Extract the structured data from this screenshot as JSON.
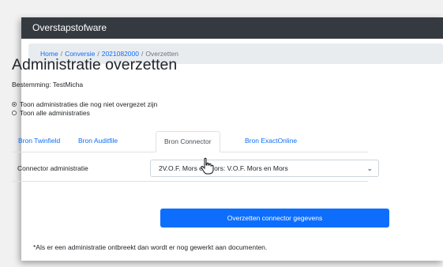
{
  "navbar": {
    "brand": "Overstapstofware"
  },
  "breadcrumb": {
    "items": [
      "Home",
      "Conversie",
      "2021082000"
    ],
    "separator": "/",
    "current": "Overzetten"
  },
  "page": {
    "title": "Administratie overzetten",
    "subtitle": "Bestemming: TestMicha"
  },
  "filters": {
    "options": [
      {
        "label": "Toon administraties die nog niet overgezet zijn",
        "checked": true
      },
      {
        "label": "Toon alle administraties",
        "checked": false
      }
    ]
  },
  "tabs": {
    "items": [
      "Bron Twinfield",
      "Bron Auditfile",
      "Bron Connector",
      "Bron ExactOnline"
    ],
    "active": "Bron Connector"
  },
  "form": {
    "label": "Connector administratie",
    "selected": "2V.O.F. Mors en Mors: V.O.F. Mors en Mors",
    "submit_label": "Overzetten connector gegevens"
  },
  "footnote": "*Als er een administratie ontbreekt dan wordt er nog gewerkt aan documenten.",
  "icons": {
    "cursor": "hand-pointer-icon",
    "select_arrow": "chevron-down-icon"
  },
  "colors": {
    "navbar": "#343a40",
    "primary": "#0d6efd",
    "breadcrumb_bg": "#e9ecef"
  }
}
